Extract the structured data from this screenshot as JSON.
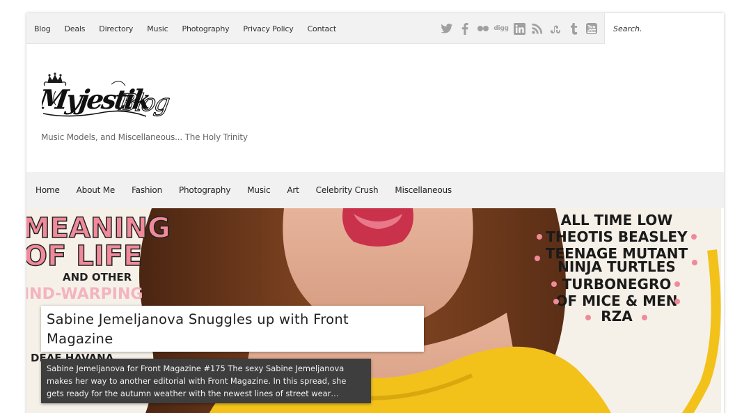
{
  "topnav": {
    "items": [
      "Blog",
      "Deals",
      "Directory",
      "Music",
      "Photography",
      "Privacy Policy",
      "Contact"
    ]
  },
  "social": {
    "icons": [
      "twitter-icon",
      "facebook-icon",
      "flickr-icon",
      "digg-icon",
      "linkedin-icon",
      "rss-icon",
      "stumbleupon-icon",
      "tumblr-icon",
      "youtube-icon"
    ],
    "digg_label": "digg",
    "youtube_label": "You Tube",
    "icon_color": "#9c9c9c"
  },
  "search": {
    "placeholder": "Search."
  },
  "header": {
    "logo_text": "Myjestik Blog",
    "tagline": "Music Models, and Miscellaneous... The Holy Trinity"
  },
  "mainnav": {
    "items": [
      "Home",
      "About Me",
      "Fashion",
      "Photography",
      "Music",
      "Art",
      "Celebrity Crush",
      "Miscellaneous"
    ]
  },
  "featured": {
    "title": "Sabine Jemeljanova Snuggles up with Front Magazine",
    "excerpt": "Sabine Jemeljanova for Front Magazine #175 The sexy Sabine Jemeljanova makes her way to another editorial with Front Magazine. In this spread, she gets ready for the autumn weather with the newest lines of street wear…",
    "cover_left_lines": [
      "MEANING",
      "OF LIFE",
      "AND OTHER",
      "IND-WARPING",
      "DEAF HAVANA"
    ],
    "cover_right_lines": [
      "ALL TIME LOW",
      "THEOTIS BEASLEY",
      "TEENAGE MUTANT",
      "NINJA TURTLES",
      "TURBONEGRO",
      "OF MICE & MEN",
      "RZA"
    ],
    "colors": {
      "pink": "#f08a9a",
      "yellow": "#f2c21a",
      "hair": "#6b3a1e"
    }
  }
}
